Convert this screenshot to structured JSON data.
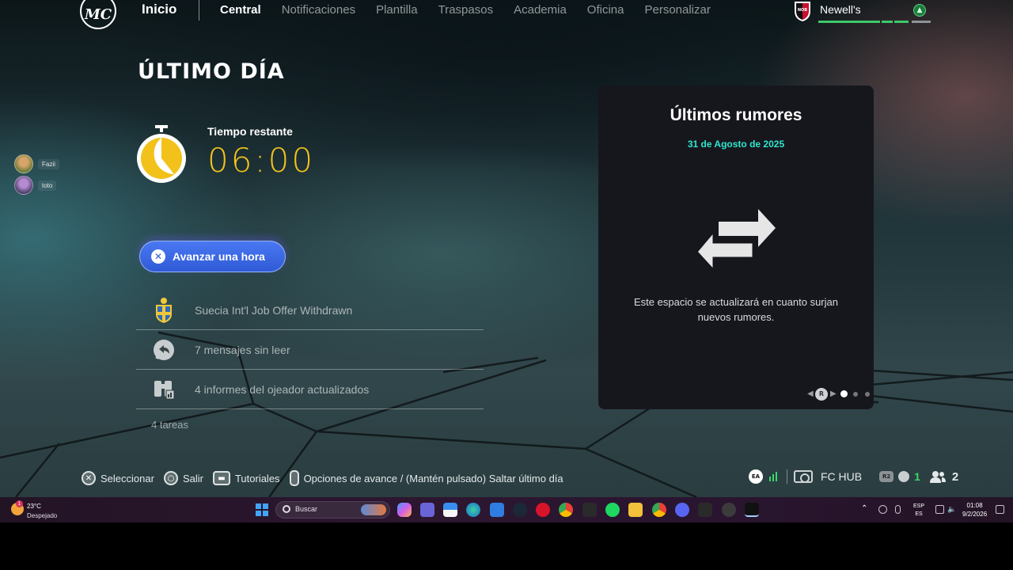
{
  "nav": {
    "logo": "MC",
    "home": "Inicio",
    "tabs": [
      {
        "label": "Central",
        "active": true
      },
      {
        "label": "Notificaciones",
        "active": false
      },
      {
        "label": "Plantilla",
        "active": false
      },
      {
        "label": "Traspasos",
        "active": false
      },
      {
        "label": "Academia",
        "active": false
      },
      {
        "label": "Oficina",
        "active": false
      },
      {
        "label": "Personalizar",
        "active": false
      }
    ],
    "club": {
      "name": "Newell's",
      "badge_text": "NOB"
    }
  },
  "main": {
    "title": "ÚLTIMO DÍA",
    "time_label": "Tiempo restante",
    "time_value": "06:00",
    "advance_button": "Avanzar una hora",
    "tasks": [
      {
        "text": "Suecia Int'l Job Offer Withdrawn",
        "icon": "sweden-crest-icon"
      },
      {
        "text": "7 mensajes sin leer",
        "icon": "reply-message-icon"
      },
      {
        "text": "4 informes del ojeador actualizados",
        "icon": "binoculars-icon"
      }
    ],
    "tasks_count": "4 tareas"
  },
  "friends": [
    {
      "name": "Fazii"
    },
    {
      "name": "toto"
    }
  ],
  "rumors": {
    "title": "Últimos rumores",
    "date": "31 de Agosto de 2025",
    "message": "Este espacio se actualizará en cuanto surjan nuevos rumores.",
    "pager_button": "R",
    "page_index": 1,
    "page_total": 3
  },
  "hints": [
    {
      "label": "Seleccionar",
      "icon": "cross-button-icon"
    },
    {
      "label": "Salir",
      "icon": "circle-button-icon"
    },
    {
      "label": "Tutoriales",
      "icon": "touchpad-icon"
    },
    {
      "label": "Opciones de avance / (Mantén pulsado) Saltar último día",
      "icon": "options-button-icon"
    }
  ],
  "status": {
    "ea": "EA",
    "hub": "FC HUB",
    "r2": "R2",
    "online": "1",
    "people": "2"
  },
  "taskbar": {
    "weather_temp": "23°C",
    "weather_desc": "Despejado",
    "weather_badge": "1",
    "search_placeholder": "Buscar",
    "lang_top": "ESP",
    "lang_bottom": "ES",
    "time": "01:08",
    "date": "9/2/2026"
  },
  "colors": {
    "accent_time": "#f2c21b",
    "rumor_date": "#2fe6cf",
    "button_blue": "#3a66e0",
    "online_green": "#3cd86a"
  }
}
